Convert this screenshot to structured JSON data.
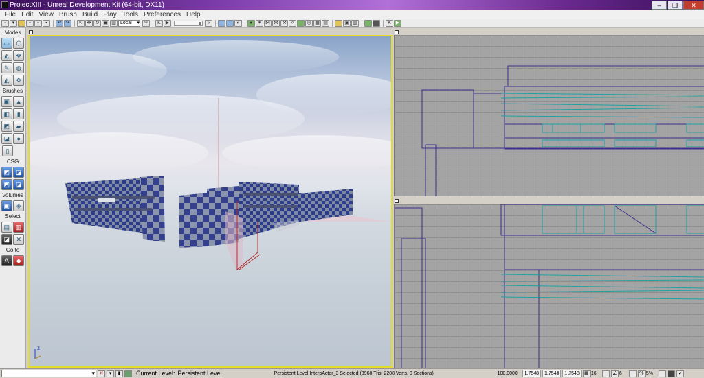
{
  "window": {
    "title": "ProjectXIII - Unreal Development Kit (64-bit, DX11)",
    "minimize": "–",
    "maximize": "❐",
    "close": "✕"
  },
  "menu": [
    "File",
    "Edit",
    "View",
    "Brush",
    "Build",
    "Play",
    "Tools",
    "Preferences",
    "Help"
  ],
  "toolbar": {
    "coordinate_space": "Local"
  },
  "modes_panel": {
    "sections": {
      "modes": "Modes",
      "brushes": "Brushes",
      "csg": "CSG",
      "volumes": "Volumes",
      "select": "Select",
      "goto": "Go to"
    },
    "goto_a": "A"
  },
  "viewport": {
    "axis_z": "z"
  },
  "status": {
    "current_level_label": "Current Level:",
    "current_level_value": "Persistent Level",
    "selection": "Persistent Level.InterpActor_3 Selected (3968 Tris, 2208 Verts, 0 Sections)",
    "drag_scale": "100.0000",
    "scale_x": "1.7548",
    "scale_y": "1.7548",
    "scale_z": "1.7548",
    "grid_size": "16",
    "rotation_snap": "6",
    "scale_snap": "5%"
  },
  "colors": {
    "viewport_border_active": "#e6dc2c",
    "wire_blue": "#3b2e8c",
    "wire_teal": "#1fa0a0",
    "checker_blue": "#2e3c8c",
    "checker_gray": "#7e8aa4"
  }
}
